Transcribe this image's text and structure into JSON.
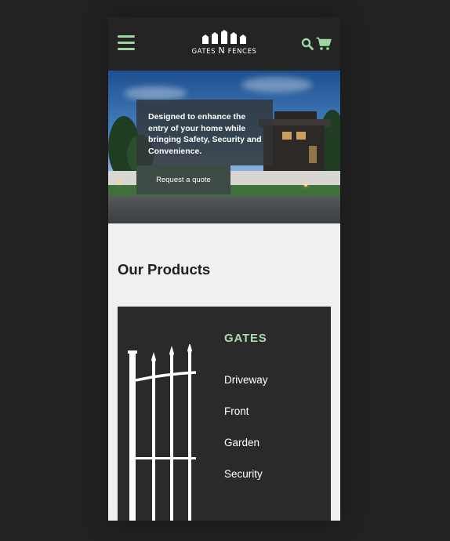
{
  "header": {
    "logo_text_left": "GATES",
    "logo_text_mid": "N",
    "logo_text_right": "FENCES",
    "menu_icon": "hamburger-menu-icon",
    "search_icon": "search-icon",
    "cart_icon": "shopping-cart-icon",
    "accent_color": "#9fd6a6"
  },
  "hero": {
    "headline": "Designed to enhance the entry of your home while bringing Safety, Security and Convenience.",
    "cta_label": "Request a quote"
  },
  "products": {
    "section_title": "Our Products",
    "card": {
      "title": "GATES",
      "title_color": "#a8dcb0",
      "links": [
        "Driveway",
        "Front",
        "Garden",
        "Security"
      ]
    }
  }
}
